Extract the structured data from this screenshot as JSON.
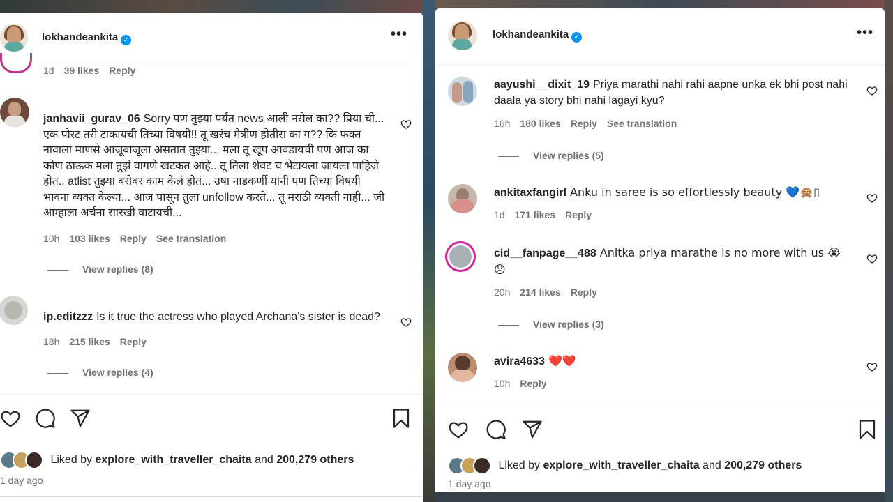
{
  "left_post": {
    "username": "lokhandeankita",
    "top_meta": {
      "time": "1d",
      "likes": "39 likes",
      "reply": "Reply"
    },
    "comments": [
      {
        "user": "janhavii_gurav_06",
        "text": "Sorry पण तुझ्या पर्यंत news आली नसेल का?? प्रिया ची... एक पोस्ट तरी टाकायची तिच्या विषयी!! तू खरंच मैत्रीण होतीस का ग?? कि फक्त नावाला माणसे आजूबाजूला असतात तुझ्या... मला तू खूप आवडायची पण आज का कोण ठाऊक मला तुझं वागणे खटकत आहे.. तू तिला शेवट च भेटायला जायला पाहिजे होतं.. atlist तुझ्या बरोबर काम केलं होतं... उषा नाडकर्णी यांनी पण तिच्या विषयी भावना व्यक्त केल्या... आज पासून तुला unfollow करते... तू मराठी व्यक्ती नाही... जी आम्हाला अर्चना सारखी वाटायची...",
        "time": "10h",
        "likes": "103 likes",
        "reply": "Reply",
        "translation": "See translation",
        "view_replies": "View replies (8)"
      },
      {
        "user": "ip.editzzz",
        "text": "Is it true the actress who played Archana's sister is dead?",
        "time": "18h",
        "likes": "215 likes",
        "reply": "Reply",
        "view_replies": "View replies (4)"
      }
    ],
    "liked_by_prefix": "Liked by",
    "liked_by_user": "explore_with_traveller_chaita",
    "liked_by_and": "and",
    "liked_by_count": "200,279 others",
    "time_ago": "1 day ago"
  },
  "right_post": {
    "username": "lokhandeankita",
    "comments": [
      {
        "user": "aayushi__dixit_19",
        "text": "Priya marathi nahi rahi aapne unka ek bhi post nahi daala ya story bhi nahi lagayi kyu?",
        "time": "16h",
        "likes": "180 likes",
        "reply": "Reply",
        "translation": "See translation",
        "view_replies": "View replies (5)"
      },
      {
        "user": "ankitaxfangirl",
        "text": "Anku in saree is so effortlessly beauty 💙🙊▯",
        "time": "1d",
        "likes": "171 likes",
        "reply": "Reply"
      },
      {
        "user": "cid__fanpage__488",
        "text": "Anitka priya marathe is no more with us 😭😞",
        "time": "20h",
        "likes": "214 likes",
        "reply": "Reply",
        "view_replies": "View replies (3)"
      },
      {
        "user": "avira4633",
        "text": "❤️❤️",
        "time": "10h",
        "reply": "Reply"
      }
    ],
    "liked_by_prefix": "Liked by",
    "liked_by_user": "explore_with_traveller_chaita",
    "liked_by_and": "and",
    "liked_by_count": "200,279 others",
    "time_ago": "1 day ago"
  },
  "colors": {
    "verified": "#0095f6",
    "muted_text": "#737373",
    "primary_text": "#262626",
    "story_ring": "#d6249f",
    "heart_red": "#ed4956"
  },
  "icons": [
    "verified-badge-icon",
    "more-options-icon",
    "heart-outline-icon",
    "comment-icon",
    "share-icon",
    "bookmark-icon"
  ]
}
